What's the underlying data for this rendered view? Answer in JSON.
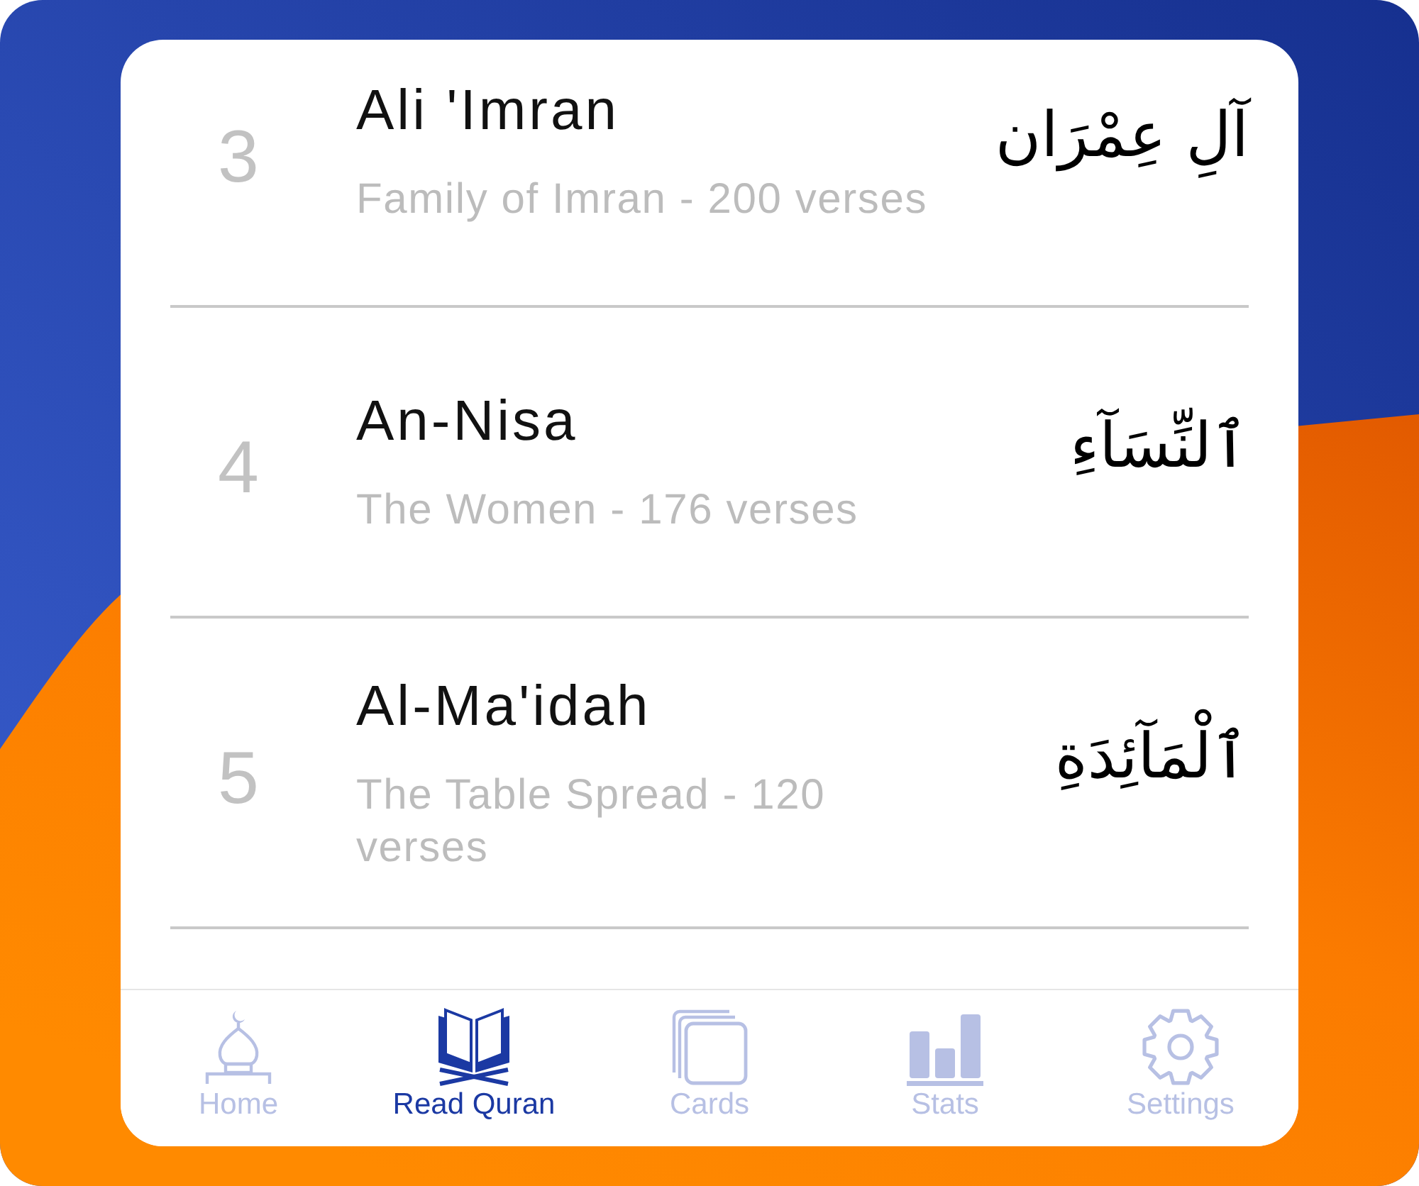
{
  "surahs": [
    {
      "number": "3",
      "name": "Ali 'Imran",
      "subtitle": "Family of Imran - 200 verses",
      "arabic": "آلِ عِمْرَان"
    },
    {
      "number": "4",
      "name": "An-Nisa",
      "subtitle": "The Women - 176 verses",
      "arabic": "ٱلنِّسَآءِ"
    },
    {
      "number": "5",
      "name": "Al-Ma'idah",
      "subtitle": "The Table Spread - 120 verses",
      "arabic": "ٱلْمَآئِدَةِ"
    }
  ],
  "tab_bar": {
    "tabs": [
      {
        "kind": "home",
        "label": "Home",
        "selected": false
      },
      {
        "kind": "quran",
        "label": "Read Quran",
        "selected": true
      },
      {
        "kind": "cards",
        "label": "Cards",
        "selected": false
      },
      {
        "kind": "stats",
        "label": "Stats",
        "selected": false
      },
      {
        "kind": "settings",
        "label": "Settings",
        "selected": false
      }
    ]
  }
}
